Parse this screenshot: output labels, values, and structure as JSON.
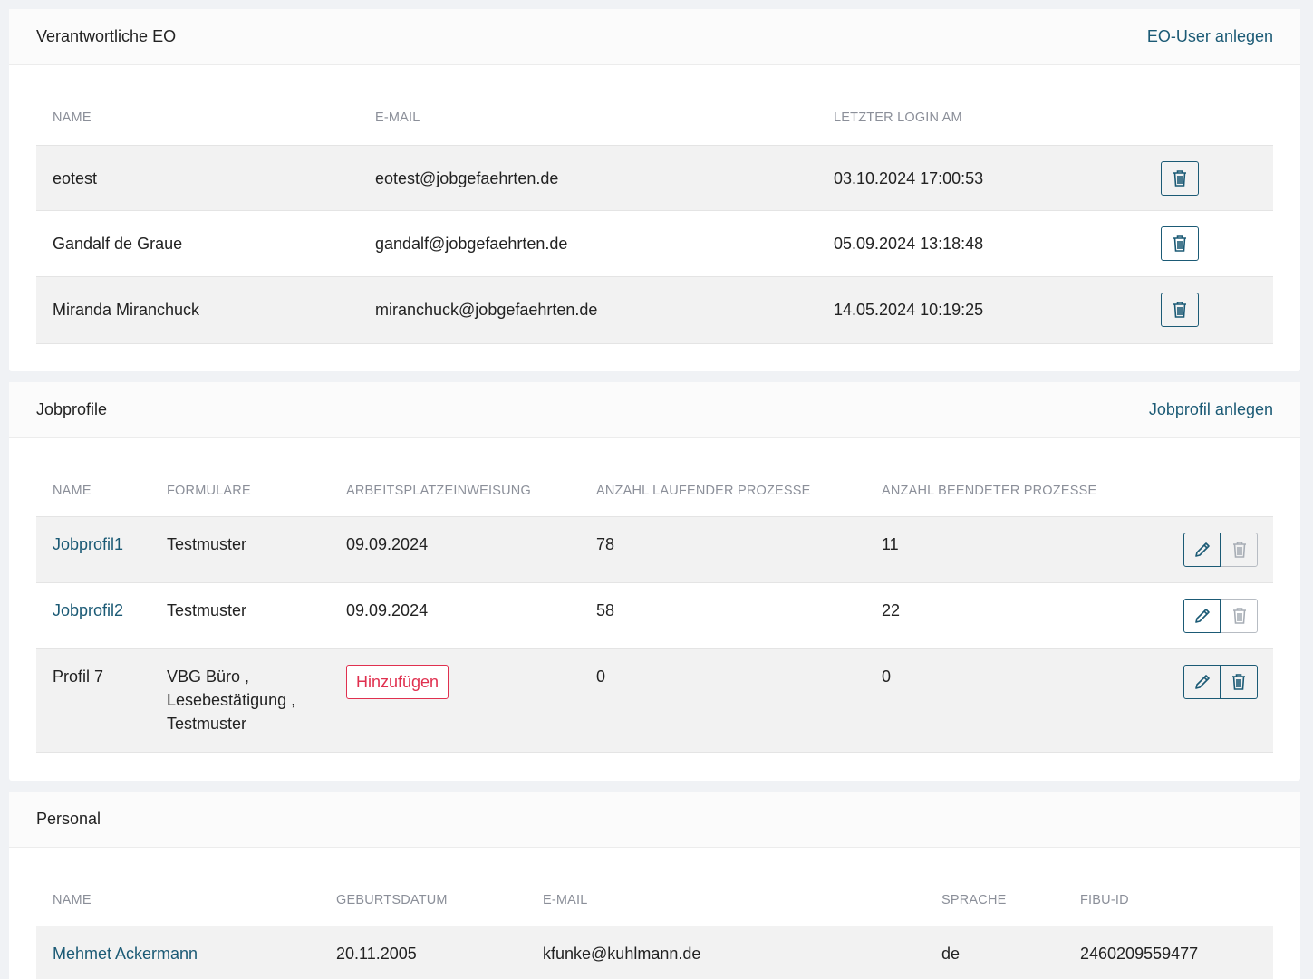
{
  "eo": {
    "title": "Verantwortliche EO",
    "action": "EO-User anlegen",
    "headers": {
      "name": "NAME",
      "email": "E-MAIL",
      "login": "LETZTER LOGIN AM"
    },
    "rows": [
      {
        "name": "eotest",
        "email": "eotest@jobgefaehrten.de",
        "login": "03.10.2024 17:00:53"
      },
      {
        "name": "Gandalf de Graue",
        "email": "gandalf@jobgefaehrten.de",
        "login": "05.09.2024 13:18:48"
      },
      {
        "name": "Miranda Miranchuck",
        "email": "miranchuck@jobgefaehrten.de",
        "login": "14.05.2024 10:19:25"
      }
    ]
  },
  "jobprofile": {
    "title": "Jobprofile",
    "action": "Jobprofil anlegen",
    "headers": {
      "name": "NAME",
      "formulare": "FORMULARE",
      "arbeitsplatz": "ARBEITSPLATZEINWEISUNG",
      "laufend": "ANZAHL LAUFENDER PROZESSE",
      "beendet": "ANZAHL BEENDETER PROZESSE"
    },
    "rows": [
      {
        "name": "Jobprofil1",
        "formulare": [
          "Testmuster"
        ],
        "arbeitsplatz": "09.09.2024",
        "laufend": "78",
        "beendet": "11"
      },
      {
        "name": "Jobprofil2",
        "formulare": [
          "Testmuster"
        ],
        "arbeitsplatz": "09.09.2024",
        "laufend": "58",
        "beendet": "22"
      },
      {
        "name": "Profil 7",
        "formulare": [
          "VBG Büro ,",
          "Lesebestätigung ,",
          "Testmuster"
        ],
        "arbeitsplatz_button": "Hinzufügen",
        "laufend": "0",
        "beendet": "0"
      }
    ]
  },
  "personal": {
    "title": "Personal",
    "headers": {
      "name": "NAME",
      "geburtsdatum": "GEBURTSDATUM",
      "email": "E-MAIL",
      "sprache": "SPRACHE",
      "fibu": "FIBU-ID"
    },
    "rows": [
      {
        "name": "Mehmet Ackermann",
        "geburtsdatum": "20.11.2005",
        "email": "kfunke@kuhlmann.de",
        "sprache": "de",
        "fibu": "2460209559477"
      }
    ]
  },
  "colors": {
    "accent": "#1b5a75",
    "danger": "#e0304f",
    "muted": "#8b8f99",
    "row_alt": "#f2f2f2"
  },
  "icons": {
    "delete": "trash-icon",
    "edit": "pencil-icon"
  }
}
